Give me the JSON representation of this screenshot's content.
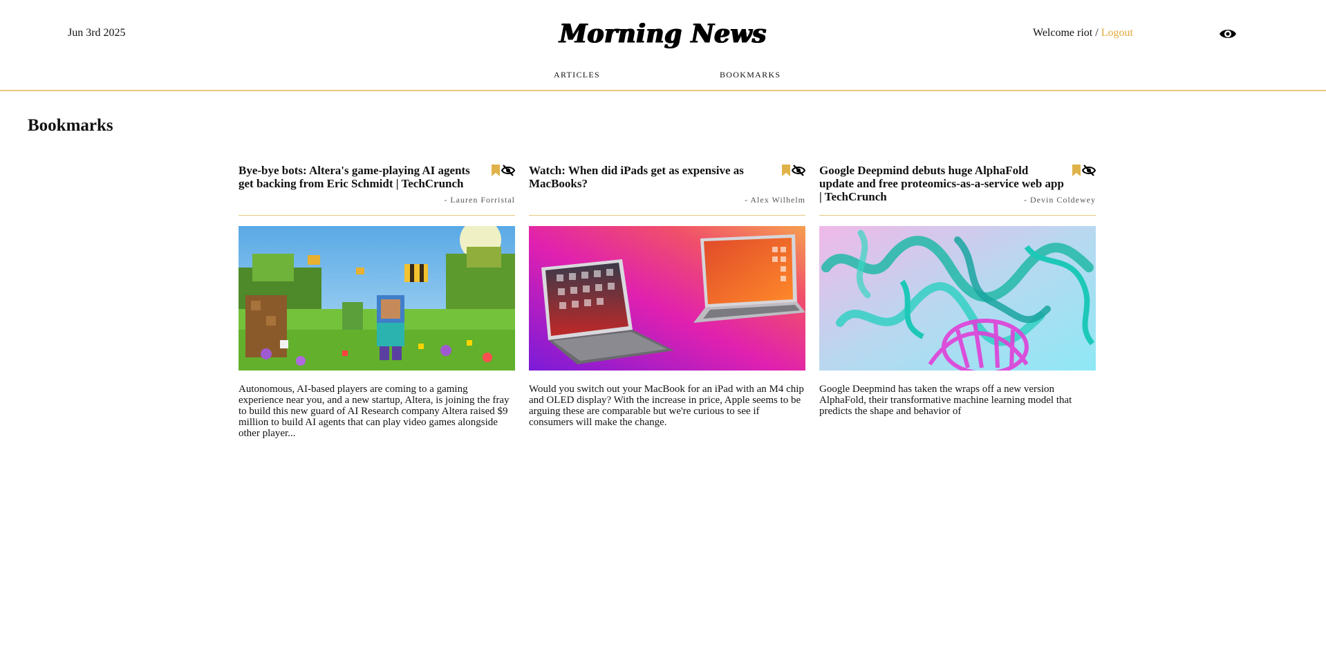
{
  "header": {
    "date": "Jun 3rd 2025",
    "logo": "Morning News",
    "welcome": "Welcome riot /",
    "logout": "Logout",
    "theme_icon": "eye-icon"
  },
  "nav": {
    "articles": "ARTICLES",
    "bookmarks": "BOOKMARKS"
  },
  "page": {
    "title": "Bookmarks"
  },
  "colors": {
    "accent": "#e0a93a",
    "rule": "#e6c77a"
  },
  "articles": [
    {
      "title": "Bye-bye bots: Altera's game-playing AI agents get backing from Eric Schmidt | TechCrunch",
      "author": "- Lauren Forristal",
      "description": "Autonomous, AI-based players are coming to a gaming experience near you, and a new startup, Altera, is joining the fray to build this new guard of AI Research company Altera raised $9 million to build AI agents that can play video games alongside other player...",
      "image": "minecraft-scene"
    },
    {
      "title": "Watch: When did iPads get as expensive as MacBooks?",
      "author": "- Alex Wilhelm",
      "description": "Would you switch out your MacBook for an iPad with an M4 chip and OLED display? With the increase in price, Apple seems to be arguing these are comparable but we're curious to see if consumers will make the change.",
      "image": "ipad-and-macbook"
    },
    {
      "title": "Google Deepmind debuts huge AlphaFold update and free proteomics-as-a-service web app | TechCrunch",
      "author": "- Devin Coldewey",
      "description": "Google Deepmind has taken the wraps off a new version AlphaFold, their transformative machine learning model that predicts the shape and behavior of",
      "image": "protein-structure"
    }
  ]
}
